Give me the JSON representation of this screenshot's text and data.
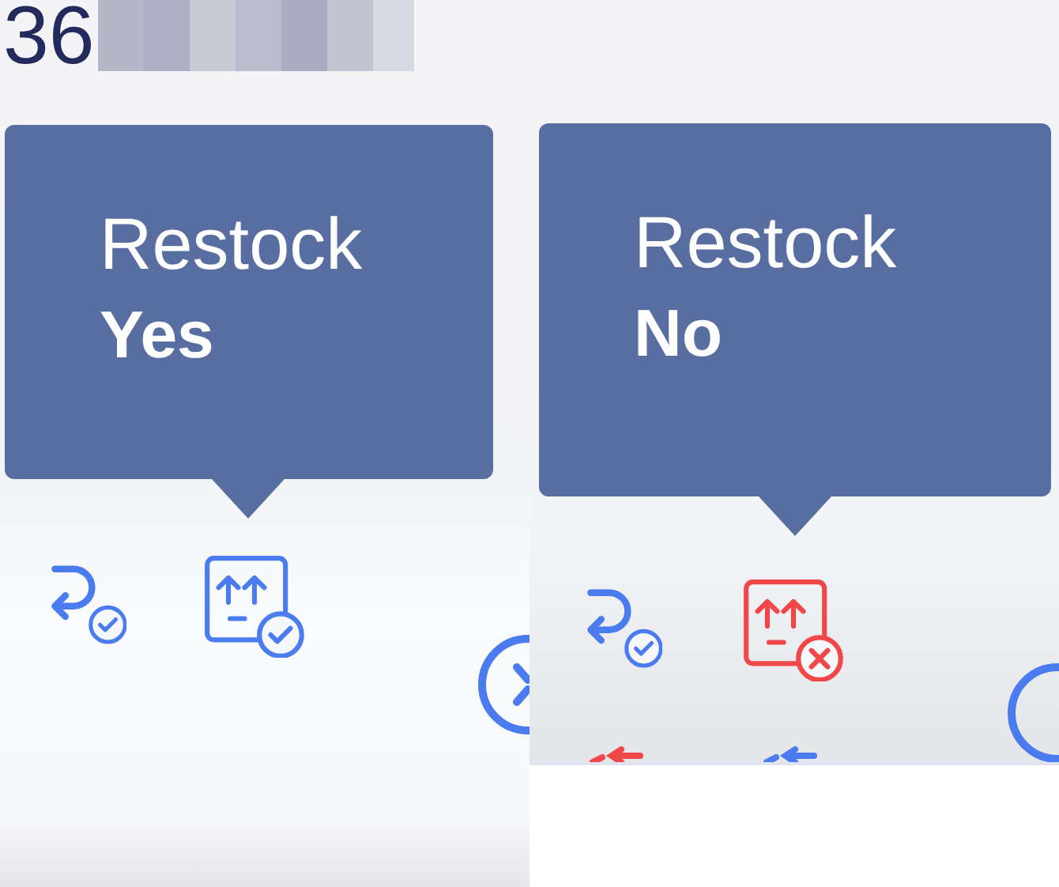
{
  "panels": [
    {
      "heading_fragment": "36",
      "tooltip": {
        "label": "Restock",
        "value": "Yes"
      },
      "actions": [
        {
          "kind": "return",
          "passed": true
        },
        {
          "kind": "restock",
          "passed": true
        }
      ]
    },
    {
      "tooltip": {
        "label": "Restock",
        "value": "No"
      },
      "actions": [
        {
          "kind": "return",
          "passed": true
        },
        {
          "kind": "restock",
          "passed": false
        }
      ]
    }
  ]
}
